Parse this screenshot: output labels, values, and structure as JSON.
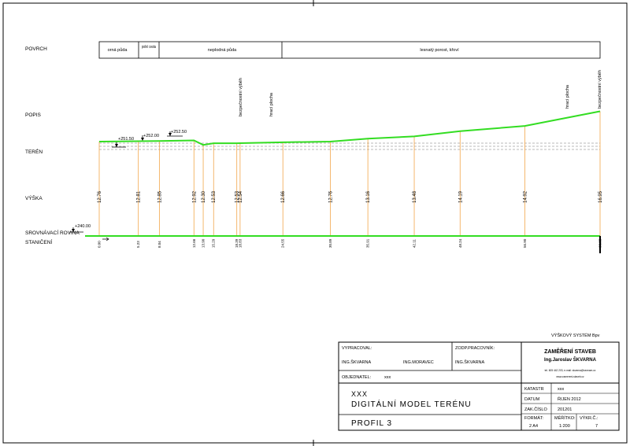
{
  "row_labels": {
    "surface": "POVRCH",
    "description": "POPIS",
    "terrain": "TERÉN",
    "height": "VÝŠKA",
    "datum": "SROVNÁVACÍ ROVINA",
    "station": "STANIČENÍ"
  },
  "surface_segments": [
    "orná půda",
    "polní cesta",
    "neplodná půda",
    "lesnatý porost, křoví"
  ],
  "descriptions": [
    "bezpečnostní výběh",
    "hrací plocha",
    "hrací plocha",
    "bezpečnostní výběh"
  ],
  "level_marks": [
    "+251.50",
    "+252.00",
    "+252.50"
  ],
  "datum_level": "+240.00",
  "chart_data": {
    "type": "line",
    "series": [
      {
        "x": [
          0.0,
          5.23,
          8.04,
          12.66,
          13.9,
          15.29,
          18.39,
          18.83,
          24.55,
          30.89,
          35.91,
          42.11,
          48.24,
          56.9,
          66.95
        ],
        "values": [
          12.76,
          12.81,
          12.85,
          12.92,
          12.3,
          12.53,
          12.53,
          12.54,
          12.66,
          12.76,
          13.16,
          13.48,
          14.19,
          14.92,
          16.95
        ]
      }
    ],
    "x_labels": [
      "0.00",
      "5.23",
      "8.04",
      "12.66",
      "13.90",
      "15.29",
      "18.39",
      "18.83",
      "24.55",
      "30.89",
      "35.91",
      "42.11",
      "48.24",
      "56.90",
      "66.95"
    ],
    "y_labels": [
      "12.76",
      "12.81",
      "12.85",
      "12.92",
      "12.30",
      "12.53",
      "12.53",
      "12.54",
      "12.66",
      "12.76",
      "13.16",
      "13.48",
      "14.19",
      "14.92",
      "16.95"
    ]
  },
  "height_system": "VÝŠKOVÝ SYSTÉM Bpv",
  "title_block": {
    "prepared_label": "VYPRACOVAL:",
    "prepared_names": [
      "ING.ŠKVARNA",
      "ING.MORAVEC"
    ],
    "responsible_label": "ZODP.PRACOVNÍK:",
    "responsible_name": "ING.ŠKVARNA",
    "company_line1": "ZAMĚŘENÍ STAVEB",
    "company_line2": "Ing.Jaroslav ŠKVARNA",
    "contact_line1": "tel. 605 442 203, e-mail: skvarna@seznam.cz",
    "contact_line2": "www.zamereni-staveb.cz",
    "client_label": "OBJEDNATEL:",
    "client_value": "xxx",
    "project_line1": "XXX",
    "project_line2": "DIGITÁLNÍ MODEL TERÉNU",
    "drawing_name": "PROFIL 3",
    "rows": [
      {
        "label": "KATASTR",
        "value": "xxx"
      },
      {
        "label": "DATUM",
        "value": "ŘIJEN 2012"
      },
      {
        "label": "ZAK.ČÍSLO",
        "value": "201201"
      }
    ],
    "format_label": "FORMÁT:",
    "format_value": "2 A4",
    "scale_label": "MĚŘÍTKO:",
    "scale_value": "1:200",
    "sheet_label": "VÝKR.Č.:",
    "sheet_value": "7"
  }
}
